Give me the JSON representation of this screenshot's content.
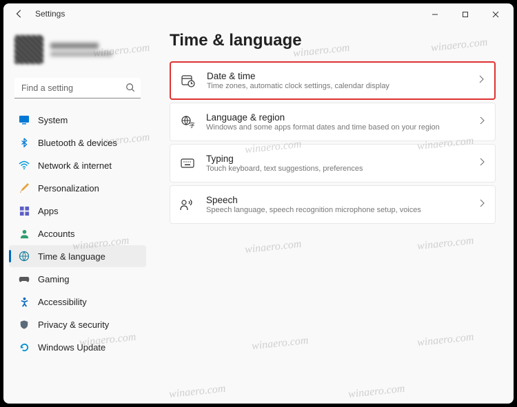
{
  "app": {
    "title": "Settings"
  },
  "search": {
    "placeholder": "Find a setting"
  },
  "sidebar": {
    "items": [
      {
        "label": "System"
      },
      {
        "label": "Bluetooth & devices"
      },
      {
        "label": "Network & internet"
      },
      {
        "label": "Personalization"
      },
      {
        "label": "Apps"
      },
      {
        "label": "Accounts"
      },
      {
        "label": "Time & language"
      },
      {
        "label": "Gaming"
      },
      {
        "label": "Accessibility"
      },
      {
        "label": "Privacy & security"
      },
      {
        "label": "Windows Update"
      }
    ]
  },
  "page": {
    "title": "Time & language",
    "cards": [
      {
        "title": "Date & time",
        "sub": "Time zones, automatic clock settings, calendar display"
      },
      {
        "title": "Language & region",
        "sub": "Windows and some apps format dates and time based on your region"
      },
      {
        "title": "Typing",
        "sub": "Touch keyboard, text suggestions, preferences"
      },
      {
        "title": "Speech",
        "sub": "Speech language, speech recognition microphone setup, voices"
      }
    ]
  },
  "watermark": "winaero.com"
}
